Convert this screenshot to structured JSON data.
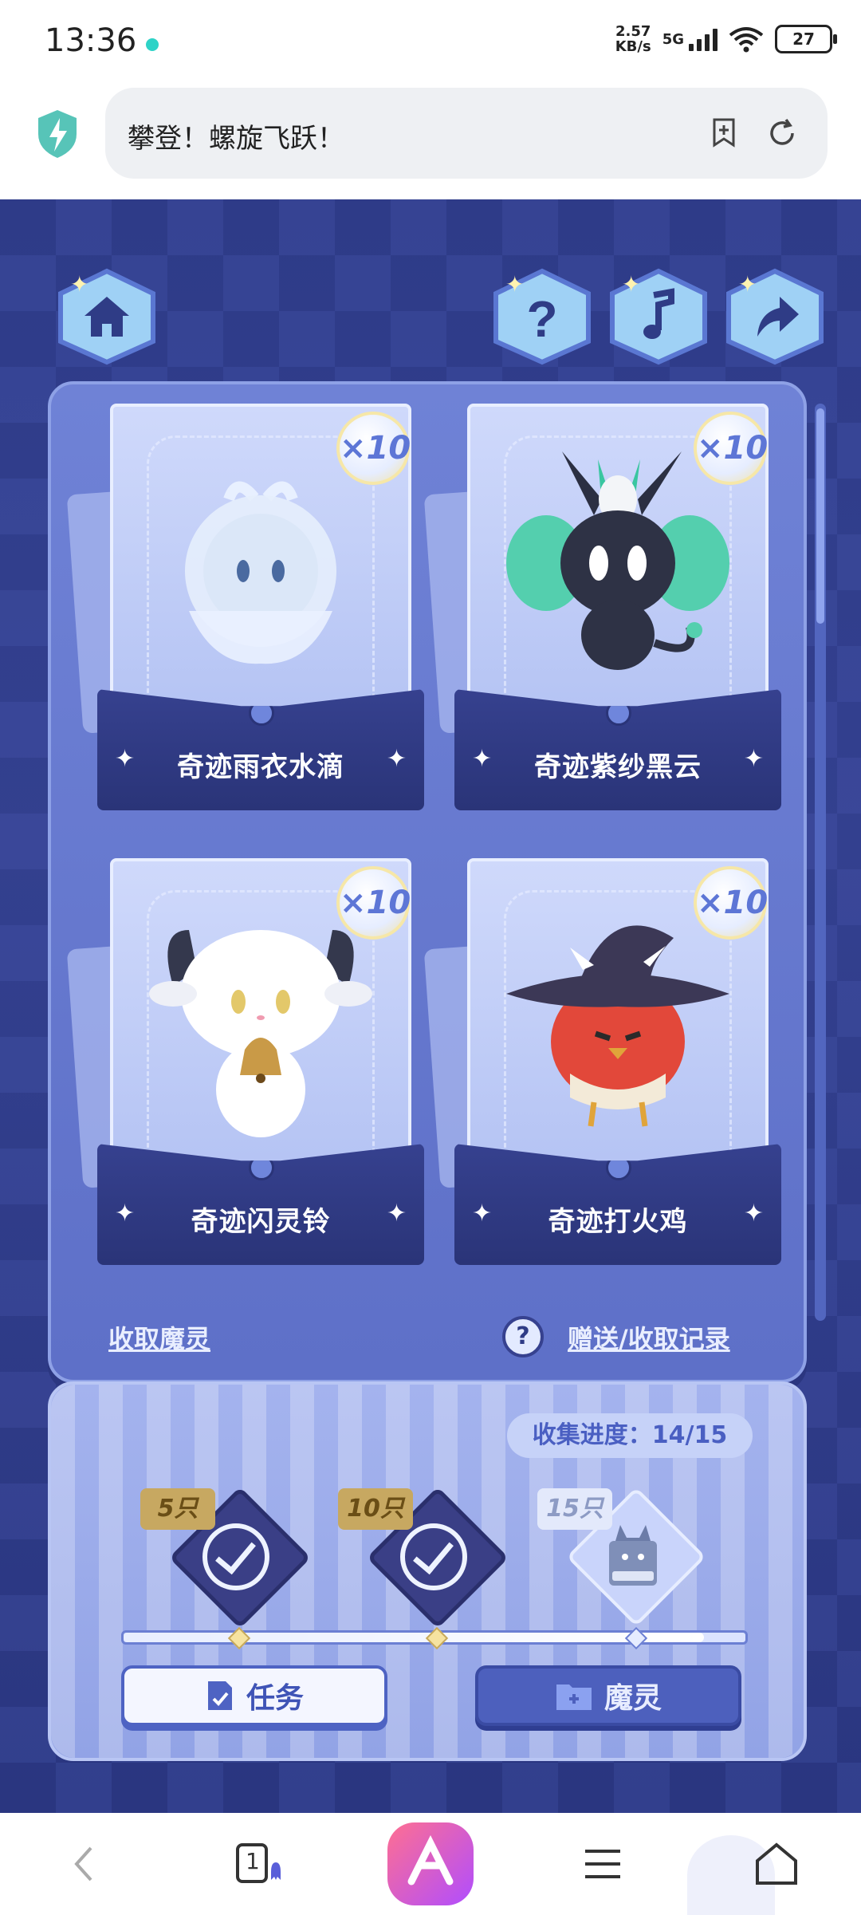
{
  "status_bar": {
    "time": "13:36",
    "net_speed_value": "2.57",
    "net_speed_unit": "KB/s",
    "network": "5G",
    "battery": "27"
  },
  "browser": {
    "page_title": "攀登！螺旋飞跃！"
  },
  "game": {
    "cards": [
      {
        "name": "奇迹雨衣水滴",
        "count": "×10"
      },
      {
        "name": "奇迹紫纱黑云",
        "count": "×10"
      },
      {
        "name": "奇迹闪灵铃",
        "count": "×10"
      },
      {
        "name": "奇迹打火鸡",
        "count": "×10"
      }
    ],
    "collect_link": "收取魔灵",
    "help_glyph": "?",
    "history_link": "赠送/收取记录",
    "progress": {
      "label": "收集进度：",
      "value": "14/15",
      "current": 14,
      "total": 15,
      "milestones": [
        {
          "label": "5只",
          "claimed": true
        },
        {
          "label": "10只",
          "claimed": true
        },
        {
          "label": "15只",
          "claimed": false
        }
      ]
    },
    "buttons": {
      "task": "任务",
      "spirit": "魔灵"
    }
  },
  "nav": {
    "tab_count": "1"
  }
}
